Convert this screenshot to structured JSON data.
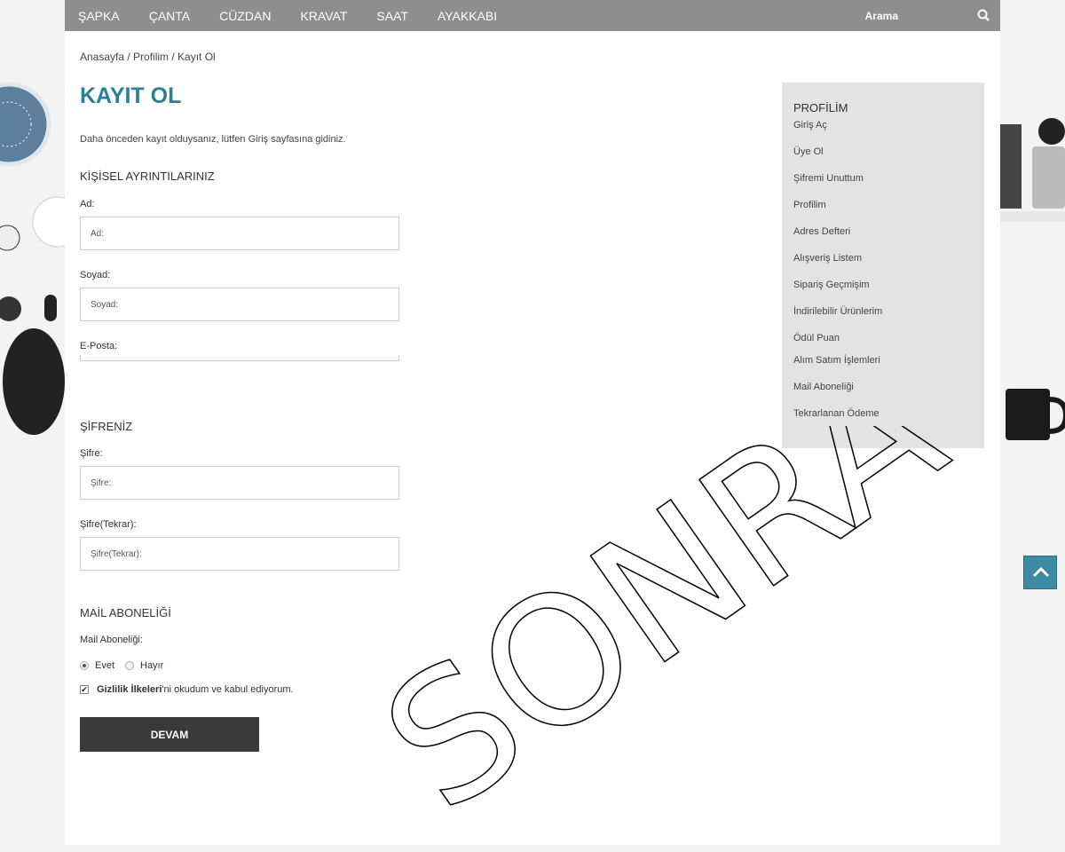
{
  "nav": {
    "items": [
      "ŞAPKA",
      "ÇANTA",
      "CÜZDAN",
      "KRAVAT",
      "SAAT",
      "AYAKKABI"
    ],
    "search_label": "Arama"
  },
  "breadcrumb": "Anasayfa / Profilim / Kayıt Ol",
  "title": "KAYIT OL",
  "intro": "Daha önceden kayıt olduysanız, lütfen Giriş sayfasına gidiniz.",
  "personal": {
    "heading": "KİŞİSEL AYRINTILARINIZ",
    "first_label": "Ad:",
    "first_placeholder": "Ad:",
    "last_label": "Soyad:",
    "last_placeholder": "Soyad:",
    "email_label": "E-Posta:"
  },
  "password": {
    "heading": "ŞİFRENİZ",
    "pw_label": "Şifre:",
    "pw_placeholder": "Şifre:",
    "pw2_label": "Şifre(Tekrar):",
    "pw2_placeholder": "Şifre(Tekrar):"
  },
  "mail": {
    "heading": "MAİL ABONELİĞİ",
    "label": "Mail Aboneliği:",
    "yes": "Evet",
    "no": "Hayır",
    "selected": "Evet"
  },
  "terms": {
    "bold": "Gizlilik İlkeleri",
    "rest": "'ni okudum ve kabul ediyorum.",
    "checked": true
  },
  "submit": "DEVAM",
  "sidebar": {
    "title": "PROFİLİM",
    "items": [
      "Giriş Aç",
      "Üye Ol",
      "Şifremi Unuttum",
      "Profilim",
      "Adres Defteri",
      "Alışveriş Listem",
      "Sipariş Geçmişim",
      "İndirilebilir Ürünlerim",
      "Ödül Puan",
      "Alım Satım İşlemleri",
      "Mail Aboneliği",
      "Tekrarlanan Ödeme"
    ]
  },
  "watermark": "SONRA",
  "colors": {
    "accent": "#2b7f97",
    "nav": "#8e8e8e",
    "button": "#3a3a3a"
  }
}
